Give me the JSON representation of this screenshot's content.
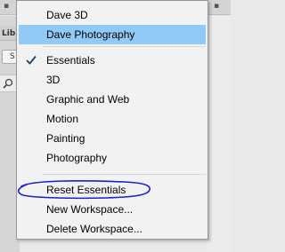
{
  "menu": {
    "group1": [
      {
        "label": "Dave 3D",
        "state": "normal"
      },
      {
        "label": "Dave Photography",
        "state": "highlighted"
      }
    ],
    "group2": [
      {
        "label": "Essentials",
        "state": "checked"
      },
      {
        "label": "3D",
        "state": "normal"
      },
      {
        "label": "Graphic and Web",
        "state": "normal"
      },
      {
        "label": "Motion",
        "state": "normal"
      },
      {
        "label": "Painting",
        "state": "normal"
      },
      {
        "label": "Photography",
        "state": "normal"
      }
    ],
    "group3": [
      {
        "label": "Reset Essentials",
        "state": "circled"
      },
      {
        "label": "New Workspace...",
        "state": "normal"
      },
      {
        "label": "Delete Workspace...",
        "state": "normal"
      }
    ]
  },
  "background": {
    "panel_tab_label": "Lib",
    "select_value": "S"
  },
  "colors": {
    "highlight": "#91c9f7",
    "menu_bg": "#f2f2f2",
    "annotation": "#1a22c8"
  },
  "icons": [
    "checkmark-icon",
    "magnifier-icon"
  ]
}
